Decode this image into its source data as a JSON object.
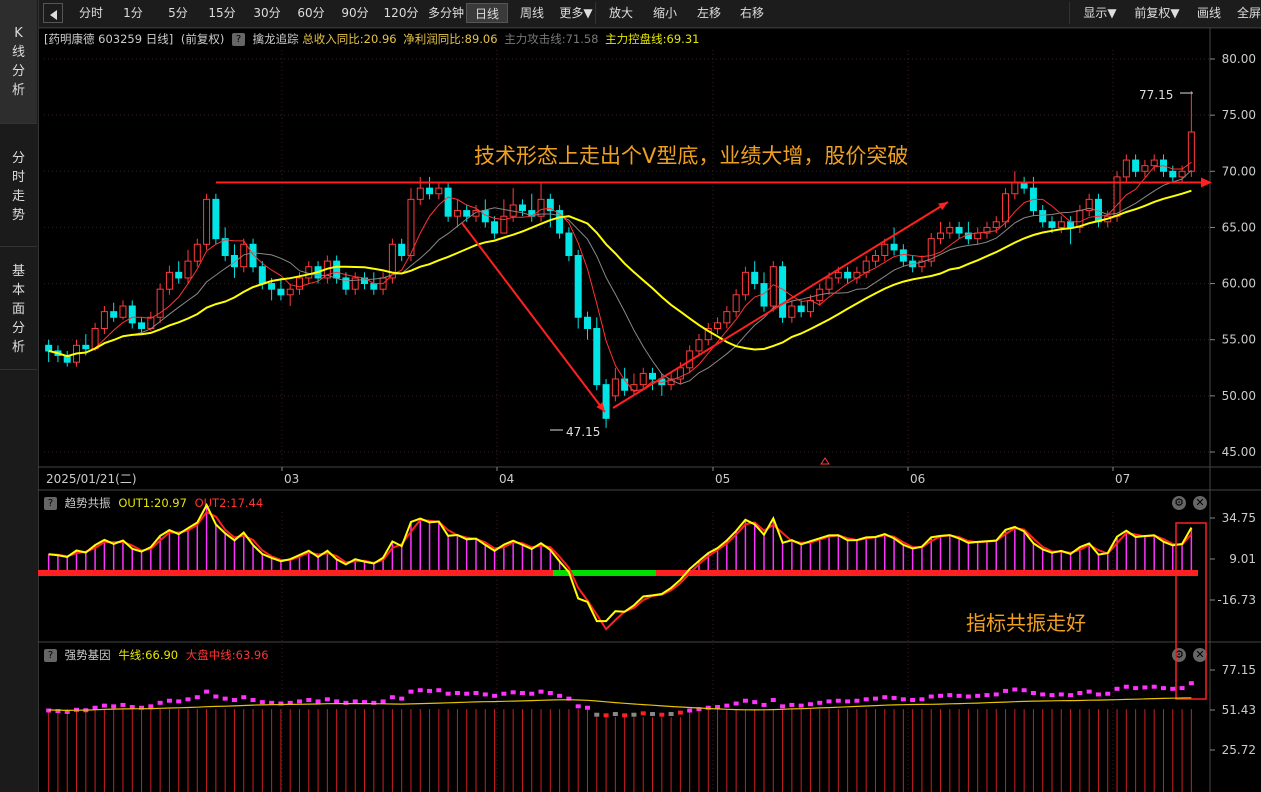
{
  "left_tabs": [
    {
      "label": "K线分析",
      "chars": [
        "K",
        "线",
        "分",
        "析"
      ],
      "active": true
    },
    {
      "label": "分时走势",
      "chars": [
        "分",
        "时",
        "走",
        "势"
      ],
      "active": false
    },
    {
      "label": "基本面分析",
      "chars": [
        "基",
        "本",
        "面",
        "分",
        "析"
      ],
      "active": false
    }
  ],
  "toolbar": {
    "buttons": [
      "分时",
      "1分",
      "5分",
      "15分",
      "30分",
      "60分",
      "90分",
      "120分",
      "多分钟",
      "日线",
      "周线",
      "更多▼",
      "放大",
      "缩小",
      "左移",
      "右移"
    ],
    "active": "日线",
    "right": [
      "显示▼",
      "前复权▼",
      "画线",
      "全屏"
    ]
  },
  "info": {
    "stock": "[药明康德 603259 日线]",
    "adjust": "(前复权)",
    "indicator": "擒龙追踪",
    "items": [
      {
        "text": "总收入同比:20.96",
        "color": "#e6c34a"
      },
      {
        "text": "净利润同比:89.06",
        "color": "#e6c34a"
      },
      {
        "text": "主力攻击线:71.58",
        "color": "#777777"
      },
      {
        "text": "主力控盘线:69.31",
        "color": "#e6e600"
      }
    ]
  },
  "price_axis": [
    "80.00",
    "75.00",
    "70.00",
    "65.00",
    "60.00",
    "55.00",
    "50.00",
    "45.00"
  ],
  "date_axis": {
    "first": "2025/01/21(二)",
    "months": [
      "03",
      "04",
      "05",
      "06",
      "07"
    ]
  },
  "annotations": {
    "main_text": "技术形态上走出个V型底，业绩大增，股价突破",
    "high_label": "77.15",
    "low_label": "47.15",
    "indicator_text": "指标共振走好"
  },
  "panel2": {
    "name": "趋势共振",
    "out1": "OUT1:20.97",
    "out2": "OUT2:17.44",
    "axis": [
      "34.75",
      "9.01",
      "-16.73"
    ]
  },
  "panel3": {
    "name": "强势基因",
    "bull": "牛线:66.90",
    "market": "大盘中线:63.96",
    "axis": [
      "77.15",
      "51.43",
      "25.72"
    ]
  },
  "colors": {
    "up": "#ff3b3b",
    "down": "#00e5e5",
    "ma": "#ffff00",
    "magenta": "#ff33ff",
    "green": "#00dd00"
  },
  "chart_data": {
    "type": "candlestick",
    "price_range": [
      45,
      80
    ],
    "candles": [
      {
        "o": 54.5,
        "c": 54.0,
        "h": 55.0,
        "l": 53.0
      },
      {
        "o": 54.0,
        "c": 53.6,
        "h": 54.5,
        "l": 53.0
      },
      {
        "o": 53.6,
        "c": 53.0,
        "h": 54.0,
        "l": 52.6
      },
      {
        "o": 53.0,
        "c": 54.5,
        "h": 55.0,
        "l": 52.6
      },
      {
        "o": 54.5,
        "c": 54.2,
        "h": 55.5,
        "l": 53.6
      },
      {
        "o": 54.2,
        "c": 56.0,
        "h": 56.5,
        "l": 54.0
      },
      {
        "o": 56.0,
        "c": 57.5,
        "h": 58.0,
        "l": 55.5
      },
      {
        "o": 57.5,
        "c": 57.0,
        "h": 58.3,
        "l": 56.6
      },
      {
        "o": 57.0,
        "c": 58.0,
        "h": 58.5,
        "l": 56.8
      },
      {
        "o": 58.0,
        "c": 56.5,
        "h": 58.5,
        "l": 56.0
      },
      {
        "o": 56.5,
        "c": 56.0,
        "h": 57.0,
        "l": 55.5
      },
      {
        "o": 56.0,
        "c": 57.0,
        "h": 57.5,
        "l": 55.8
      },
      {
        "o": 57.0,
        "c": 59.5,
        "h": 60.0,
        "l": 56.5
      },
      {
        "o": 59.5,
        "c": 61.0,
        "h": 61.6,
        "l": 59.0
      },
      {
        "o": 61.0,
        "c": 60.5,
        "h": 62.0,
        "l": 60.0
      },
      {
        "o": 60.5,
        "c": 62.0,
        "h": 63.0,
        "l": 60.0
      },
      {
        "o": 62.0,
        "c": 63.5,
        "h": 64.0,
        "l": 61.5
      },
      {
        "o": 63.5,
        "c": 67.5,
        "h": 68.0,
        "l": 63.0
      },
      {
        "o": 67.5,
        "c": 64.0,
        "h": 68.0,
        "l": 63.5
      },
      {
        "o": 64.0,
        "c": 62.5,
        "h": 65.0,
        "l": 62.0
      },
      {
        "o": 62.5,
        "c": 61.5,
        "h": 63.5,
        "l": 60.5
      },
      {
        "o": 61.5,
        "c": 63.5,
        "h": 64.0,
        "l": 61.0
      },
      {
        "o": 63.5,
        "c": 61.5,
        "h": 64.0,
        "l": 61.0
      },
      {
        "o": 61.5,
        "c": 60.0,
        "h": 62.0,
        "l": 59.5
      },
      {
        "o": 60.0,
        "c": 59.5,
        "h": 60.5,
        "l": 58.5
      },
      {
        "o": 59.5,
        "c": 59.0,
        "h": 60.5,
        "l": 58.5
      },
      {
        "o": 59.0,
        "c": 59.5,
        "h": 60.0,
        "l": 58.0
      },
      {
        "o": 59.5,
        "c": 60.5,
        "h": 61.0,
        "l": 59.0
      },
      {
        "o": 60.5,
        "c": 61.5,
        "h": 62.0,
        "l": 60.0
      },
      {
        "o": 61.5,
        "c": 60.5,
        "h": 62.0,
        "l": 60.0
      },
      {
        "o": 60.5,
        "c": 62.0,
        "h": 62.5,
        "l": 60.0
      },
      {
        "o": 62.0,
        "c": 60.5,
        "h": 62.5,
        "l": 60.0
      },
      {
        "o": 60.5,
        "c": 59.5,
        "h": 61.0,
        "l": 59.0
      },
      {
        "o": 59.5,
        "c": 60.5,
        "h": 61.0,
        "l": 59.0
      },
      {
        "o": 60.5,
        "c": 60.0,
        "h": 61.0,
        "l": 59.5
      },
      {
        "o": 60.0,
        "c": 59.5,
        "h": 61.0,
        "l": 59.0
      },
      {
        "o": 59.5,
        "c": 60.5,
        "h": 61.0,
        "l": 59.0
      },
      {
        "o": 60.5,
        "c": 63.5,
        "h": 64.0,
        "l": 60.0
      },
      {
        "o": 63.5,
        "c": 62.5,
        "h": 64.0,
        "l": 62.0
      },
      {
        "o": 62.5,
        "c": 67.5,
        "h": 68.5,
        "l": 62.0
      },
      {
        "o": 67.5,
        "c": 68.5,
        "h": 69.5,
        "l": 67.0
      },
      {
        "o": 68.5,
        "c": 68.0,
        "h": 69.5,
        "l": 67.5
      },
      {
        "o": 68.0,
        "c": 68.5,
        "h": 69.0,
        "l": 67.5
      },
      {
        "o": 68.5,
        "c": 66.0,
        "h": 69.0,
        "l": 65.5
      },
      {
        "o": 66.0,
        "c": 66.5,
        "h": 67.5,
        "l": 65.0
      },
      {
        "o": 66.5,
        "c": 66.0,
        "h": 67.0,
        "l": 65.5
      },
      {
        "o": 66.0,
        "c": 66.5,
        "h": 67.0,
        "l": 65.5
      },
      {
        "o": 66.5,
        "c": 65.5,
        "h": 67.5,
        "l": 65.0
      },
      {
        "o": 65.5,
        "c": 64.5,
        "h": 66.0,
        "l": 64.0
      },
      {
        "o": 64.5,
        "c": 66.0,
        "h": 67.5,
        "l": 64.5
      },
      {
        "o": 66.0,
        "c": 67.0,
        "h": 68.5,
        "l": 65.5
      },
      {
        "o": 67.0,
        "c": 66.5,
        "h": 67.5,
        "l": 66.0
      },
      {
        "o": 66.5,
        "c": 66.0,
        "h": 68.0,
        "l": 65.5
      },
      {
        "o": 66.0,
        "c": 67.5,
        "h": 69.0,
        "l": 65.5
      },
      {
        "o": 67.5,
        "c": 66.5,
        "h": 68.0,
        "l": 65.0
      },
      {
        "o": 66.5,
        "c": 64.5,
        "h": 67.0,
        "l": 64.0
      },
      {
        "o": 64.5,
        "c": 62.5,
        "h": 65.0,
        "l": 62.0
      },
      {
        "o": 62.5,
        "c": 57.0,
        "h": 63.0,
        "l": 56.0
      },
      {
        "o": 57.0,
        "c": 56.0,
        "h": 57.5,
        "l": 55.0
      },
      {
        "o": 56.0,
        "c": 51.0,
        "h": 57.0,
        "l": 50.5
      },
      {
        "o": 51.0,
        "c": 48.0,
        "h": 51.5,
        "l": 47.15
      },
      {
        "o": 50.0,
        "c": 51.5,
        "h": 52.5,
        "l": 49.5
      },
      {
        "o": 51.5,
        "c": 50.5,
        "h": 52.5,
        "l": 50.0
      },
      {
        "o": 50.5,
        "c": 51.0,
        "h": 52.0,
        "l": 50.0
      },
      {
        "o": 51.0,
        "c": 52.0,
        "h": 52.5,
        "l": 50.5
      },
      {
        "o": 52.0,
        "c": 51.5,
        "h": 52.5,
        "l": 50.5
      },
      {
        "o": 51.5,
        "c": 51.0,
        "h": 52.0,
        "l": 50.0
      },
      {
        "o": 51.0,
        "c": 51.5,
        "h": 52.0,
        "l": 50.5
      },
      {
        "o": 51.5,
        "c": 52.5,
        "h": 53.0,
        "l": 51.0
      },
      {
        "o": 52.5,
        "c": 54.0,
        "h": 54.5,
        "l": 52.0
      },
      {
        "o": 54.0,
        "c": 55.0,
        "h": 55.5,
        "l": 53.5
      },
      {
        "o": 55.0,
        "c": 56.0,
        "h": 56.5,
        "l": 54.5
      },
      {
        "o": 56.0,
        "c": 56.5,
        "h": 57.0,
        "l": 55.5
      },
      {
        "o": 56.5,
        "c": 57.5,
        "h": 58.0,
        "l": 56.0
      },
      {
        "o": 57.5,
        "c": 59.0,
        "h": 59.5,
        "l": 57.0
      },
      {
        "o": 59.0,
        "c": 61.0,
        "h": 61.5,
        "l": 58.5
      },
      {
        "o": 61.0,
        "c": 60.0,
        "h": 62.0,
        "l": 59.5
      },
      {
        "o": 60.0,
        "c": 58.0,
        "h": 61.0,
        "l": 57.5
      },
      {
        "o": 58.0,
        "c": 61.5,
        "h": 62.0,
        "l": 57.5
      },
      {
        "o": 61.5,
        "c": 57.0,
        "h": 62.0,
        "l": 56.5
      },
      {
        "o": 57.0,
        "c": 58.0,
        "h": 58.5,
        "l": 56.5
      },
      {
        "o": 58.0,
        "c": 57.5,
        "h": 58.5,
        "l": 57.0
      },
      {
        "o": 57.5,
        "c": 58.5,
        "h": 59.0,
        "l": 57.0
      },
      {
        "o": 58.5,
        "c": 59.5,
        "h": 60.0,
        "l": 58.0
      },
      {
        "o": 59.5,
        "c": 60.5,
        "h": 61.0,
        "l": 59.0
      },
      {
        "o": 60.5,
        "c": 61.0,
        "h": 61.5,
        "l": 60.0
      },
      {
        "o": 61.0,
        "c": 60.5,
        "h": 61.5,
        "l": 60.0
      },
      {
        "o": 60.5,
        "c": 61.0,
        "h": 61.5,
        "l": 60.0
      },
      {
        "o": 61.0,
        "c": 62.0,
        "h": 62.5,
        "l": 60.5
      },
      {
        "o": 62.0,
        "c": 62.5,
        "h": 63.0,
        "l": 61.5
      },
      {
        "o": 62.5,
        "c": 63.5,
        "h": 64.0,
        "l": 62.0
      },
      {
        "o": 63.5,
        "c": 63.0,
        "h": 65.0,
        "l": 62.5
      },
      {
        "o": 63.0,
        "c": 62.0,
        "h": 63.5,
        "l": 61.5
      },
      {
        "o": 62.0,
        "c": 61.5,
        "h": 62.5,
        "l": 61.0
      },
      {
        "o": 61.5,
        "c": 62.0,
        "h": 62.5,
        "l": 61.0
      },
      {
        "o": 62.0,
        "c": 64.0,
        "h": 64.5,
        "l": 61.5
      },
      {
        "o": 64.0,
        "c": 64.5,
        "h": 65.5,
        "l": 63.5
      },
      {
        "o": 64.5,
        "c": 65.0,
        "h": 65.5,
        "l": 64.0
      },
      {
        "o": 65.0,
        "c": 64.5,
        "h": 65.5,
        "l": 64.0
      },
      {
        "o": 64.5,
        "c": 64.0,
        "h": 65.5,
        "l": 63.5
      },
      {
        "o": 64.0,
        "c": 64.5,
        "h": 65.0,
        "l": 63.5
      },
      {
        "o": 64.5,
        "c": 65.0,
        "h": 65.5,
        "l": 64.0
      },
      {
        "o": 65.0,
        "c": 65.5,
        "h": 66.0,
        "l": 64.5
      },
      {
        "o": 65.5,
        "c": 68.0,
        "h": 68.5,
        "l": 65.0
      },
      {
        "o": 68.0,
        "c": 69.0,
        "h": 70.0,
        "l": 67.5
      },
      {
        "o": 69.0,
        "c": 68.5,
        "h": 69.5,
        "l": 68.0
      },
      {
        "o": 68.5,
        "c": 66.5,
        "h": 69.5,
        "l": 66.0
      },
      {
        "o": 66.5,
        "c": 65.5,
        "h": 67.0,
        "l": 65.0
      },
      {
        "o": 65.5,
        "c": 65.0,
        "h": 66.0,
        "l": 64.5
      },
      {
        "o": 65.0,
        "c": 65.5,
        "h": 66.0,
        "l": 64.5
      },
      {
        "o": 65.5,
        "c": 65.0,
        "h": 66.0,
        "l": 63.5
      },
      {
        "o": 65.0,
        "c": 66.5,
        "h": 67.0,
        "l": 64.5
      },
      {
        "o": 66.5,
        "c": 67.5,
        "h": 68.0,
        "l": 66.0
      },
      {
        "o": 67.5,
        "c": 65.5,
        "h": 68.0,
        "l": 65.0
      },
      {
        "o": 65.5,
        "c": 66.0,
        "h": 66.5,
        "l": 65.0
      },
      {
        "o": 66.0,
        "c": 69.5,
        "h": 70.0,
        "l": 65.5
      },
      {
        "o": 69.5,
        "c": 71.0,
        "h": 71.5,
        "l": 69.0
      },
      {
        "o": 71.0,
        "c": 70.0,
        "h": 71.5,
        "l": 69.5
      },
      {
        "o": 70.0,
        "c": 70.5,
        "h": 71.0,
        "l": 69.5
      },
      {
        "o": 70.5,
        "c": 71.0,
        "h": 71.5,
        "l": 70.0
      },
      {
        "o": 71.0,
        "c": 70.0,
        "h": 71.5,
        "l": 69.5
      },
      {
        "o": 70.0,
        "c": 69.5,
        "h": 70.5,
        "l": 69.0
      },
      {
        "o": 69.5,
        "c": 70.0,
        "h": 70.5,
        "l": 69.0
      },
      {
        "o": 70.0,
        "c": 73.5,
        "h": 77.15,
        "l": 69.5
      }
    ],
    "trend_line_price": 69.0,
    "osc_range": [
      -30,
      40
    ],
    "strength_range": [
      0,
      90
    ]
  }
}
